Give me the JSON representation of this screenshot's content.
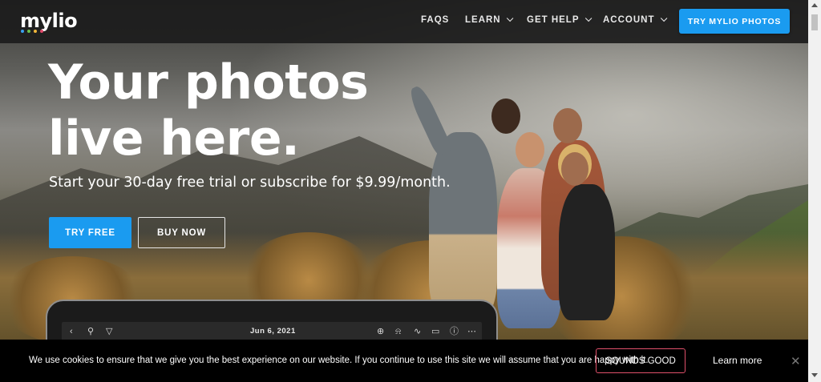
{
  "brand": {
    "name": "mylio",
    "dot_colors": [
      "#3aa0f0",
      "#6bc04b",
      "#f0b63a",
      "#e04a6a"
    ]
  },
  "nav": {
    "items": [
      {
        "label": "FAQS",
        "dropdown": false
      },
      {
        "label": "LEARN",
        "dropdown": true
      },
      {
        "label": "GET HELP",
        "dropdown": true
      },
      {
        "label": "ACCOUNT",
        "dropdown": true
      }
    ],
    "cta_label": "TRY MYLIO PHOTOS"
  },
  "hero": {
    "headline_line1": "Your photos",
    "headline_line2": "live here.",
    "subtitle": "Start your 30-day free trial or subscribe for $9.99/month.",
    "primary_button": "TRY FREE",
    "secondary_button": "BUY NOW"
  },
  "device": {
    "date_label": "Jun 6, 2021",
    "icons": [
      "back-icon",
      "search-icon",
      "filter-icon",
      "add-icon",
      "bell-icon",
      "activity-icon",
      "devices-icon",
      "help-icon",
      "more-icon"
    ]
  },
  "cookie": {
    "message": "We use cookies to ensure that we give you the best experience on our website. If you continue to use this site we will assume that you are happy with it.",
    "accept_label": "SOUNDS GOOD",
    "learn_more_label": "Learn more",
    "close_glyph": "✕"
  },
  "colors": {
    "accent": "#1a9bf0",
    "cookie_button_border": "#e0506a",
    "nav_bg": "#1c1c1c"
  }
}
